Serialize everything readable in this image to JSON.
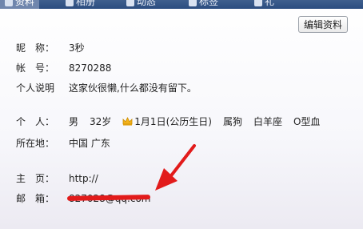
{
  "tabs": [
    {
      "label": "资料",
      "active": true
    },
    {
      "label": "相册",
      "active": false
    },
    {
      "label": "动态",
      "active": false
    },
    {
      "label": "标签",
      "active": false
    },
    {
      "label": "礼",
      "active": false
    }
  ],
  "edit_button": "编辑资料",
  "profile": {
    "nickname_label": "昵　称：",
    "nickname": "3秒",
    "account_label": "帐　号：",
    "account": "8270288",
    "bio_label": "个人说明",
    "bio": "这家伙很懒,什么都没有留下。",
    "personal_label": "个　人：",
    "gender": "男",
    "age": "32岁",
    "birthday": "1月1日(公历生日)",
    "zodiac": "属狗",
    "constellation": "白羊座",
    "blood": "O型血",
    "location_label": "所在地：",
    "location": "中国 广东",
    "homepage_label": "主　页：",
    "homepage": "http://",
    "email_label": "邮　箱：",
    "email": "827028@qq.com"
  },
  "colors": {
    "annotation": "#e21b1b",
    "tabbar": "#2b4d80"
  }
}
